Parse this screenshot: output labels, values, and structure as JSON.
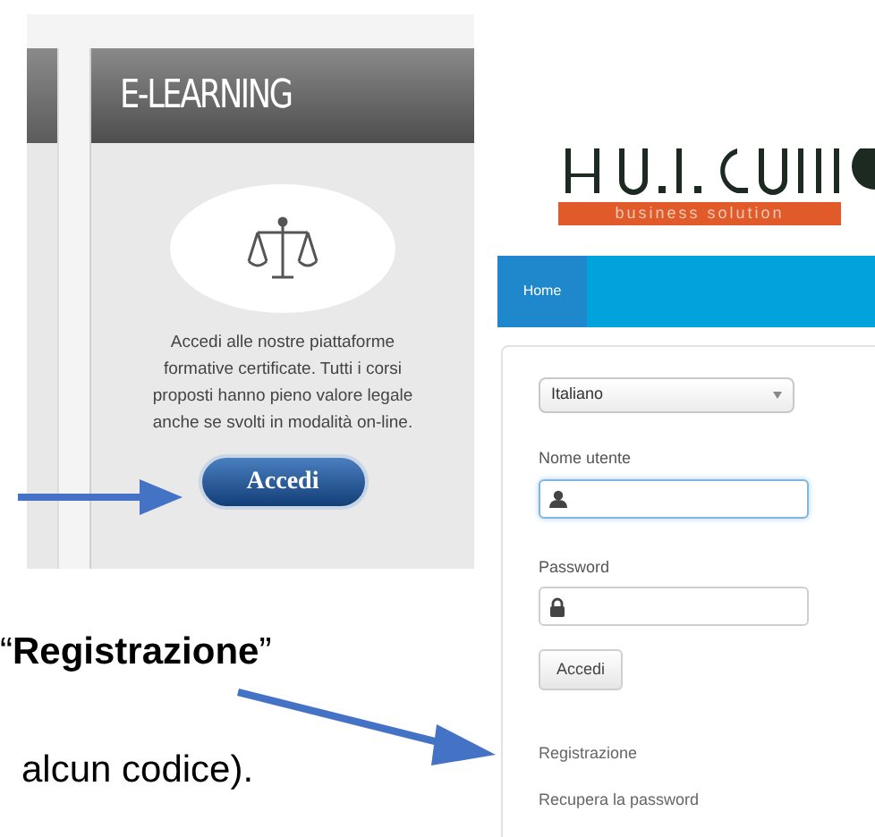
{
  "elearning_card": {
    "title": "E-LEARNING",
    "description": "Accedi alle nostre piattaforme formative certificate. Tutti i corsi proposti hanno pieno valore legale anche se svolti in modalità on-line.",
    "button": "Accedi"
  },
  "document_text": [
    "“**Registrazione**”",
    "alcun codice)."
  ],
  "login_page": {
    "logo_tagline": "business solution",
    "nav": [
      {
        "label": "Home",
        "selected": true
      }
    ],
    "language_select": {
      "value": "Italiano"
    },
    "fields": [
      {
        "label": "Nome utente",
        "kind": "user",
        "focused": true
      },
      {
        "label": "Password",
        "kind": "password",
        "focused": false
      }
    ],
    "button": "Accedi",
    "links": [
      "Registrazione",
      "Recupera la password"
    ]
  }
}
